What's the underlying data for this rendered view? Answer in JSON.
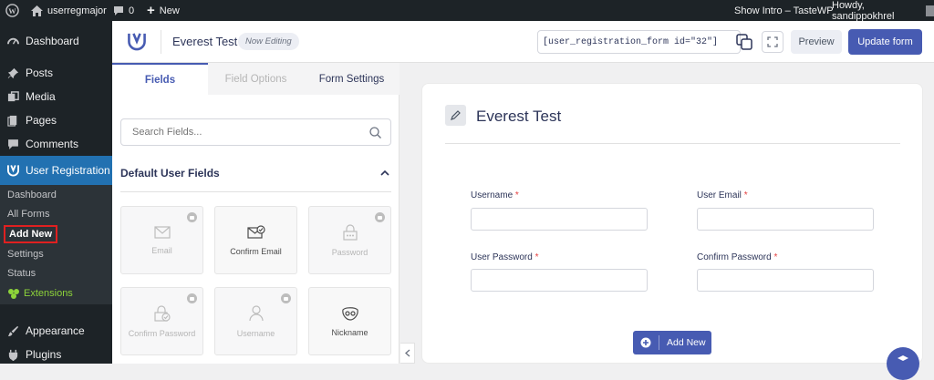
{
  "adminbar": {
    "site_name": "userregmajor",
    "comments_count": "0",
    "new_label": "New",
    "show_intro": "Show Intro – TasteWP",
    "howdy": "Howdy, sandippokhrel"
  },
  "sidebar": {
    "items": [
      {
        "label": "Dashboard",
        "icon": "dashboard-icon"
      },
      {
        "label": "Posts",
        "icon": "pin-icon"
      },
      {
        "label": "Media",
        "icon": "media-icon"
      },
      {
        "label": "Pages",
        "icon": "pages-icon"
      },
      {
        "label": "Comments",
        "icon": "comment-icon"
      },
      {
        "label": "User Registration",
        "icon": "ur-logo-icon"
      },
      {
        "label": "Appearance",
        "icon": "brush-icon"
      },
      {
        "label": "Plugins",
        "icon": "plugin-icon"
      }
    ],
    "submenu": [
      {
        "label": "Dashboard"
      },
      {
        "label": "All Forms"
      },
      {
        "label": "Add New"
      },
      {
        "label": "Settings"
      },
      {
        "label": "Status"
      },
      {
        "label": "Extensions"
      }
    ]
  },
  "header": {
    "form_title": "Everest Test",
    "status_badge": "Now Editing",
    "shortcode": "[user_registration_form id=\"32\"]",
    "preview_label": "Preview",
    "update_label": "Update form"
  },
  "panel": {
    "tabs": [
      {
        "label": "Fields"
      },
      {
        "label": "Field Options"
      },
      {
        "label": "Form Settings"
      }
    ],
    "search_placeholder": "Search Fields...",
    "section_title": "Default User Fields",
    "fields": [
      {
        "label": "Email",
        "icon": "envelope-icon",
        "enabled": false
      },
      {
        "label": "Confirm Email",
        "icon": "envelope-check-icon",
        "enabled": true
      },
      {
        "label": "Password",
        "icon": "lock-dots-icon",
        "enabled": false
      },
      {
        "label": "Confirm Password",
        "icon": "lock-check-icon",
        "enabled": false
      },
      {
        "label": "Username",
        "icon": "user-icon",
        "enabled": false
      },
      {
        "label": "Nickname",
        "icon": "mask-icon",
        "enabled": true
      }
    ]
  },
  "canvas": {
    "title": "Everest Test",
    "fields": [
      {
        "label": "Username",
        "required": "*"
      },
      {
        "label": "User Email",
        "required": "*"
      },
      {
        "label": "User Password",
        "required": "*"
      },
      {
        "label": "Confirm Password",
        "required": "*"
      }
    ],
    "add_new_label": "Add New"
  },
  "colors": {
    "admin_bg": "#1d2327",
    "accent": "#2271b1",
    "brand": "#475bb2",
    "highlight_border": "#e02020",
    "extensions_green": "#8dd33a"
  }
}
